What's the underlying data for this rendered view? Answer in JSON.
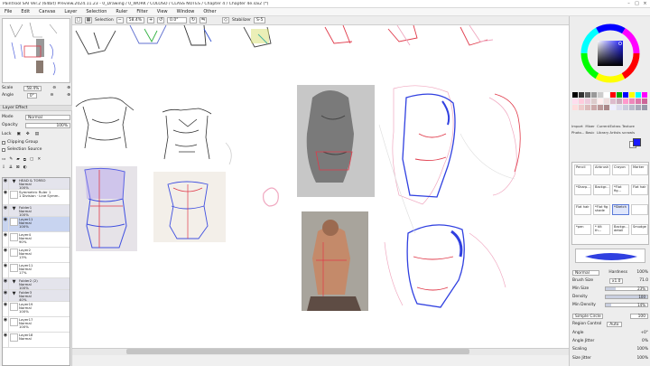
{
  "window": {
    "title": "PaintTool SAI Ver.2 (64bit) Preview.2024.11.23 - 0_Drawing / 0_WORK / COLOSO / CLASS NOTES / Chapter 4 / Chapter 4e.sai2 (*)",
    "controls": [
      "–",
      "□",
      "×"
    ]
  },
  "menu": [
    "File",
    "Edit",
    "Canvas",
    "Layer",
    "Selection",
    "Ruler",
    "Filter",
    "View",
    "Window",
    "Other"
  ],
  "toolbar": {
    "selection_label": "Selection",
    "zoom_value": "58.4%",
    "rotation_value": "0.0°",
    "stabilizer_label": "Stabilizer",
    "stabilizer_value": "S-5"
  },
  "left": {
    "scale_label": "Scale",
    "scale_value": "58.4%",
    "angle_label": "Angle",
    "angle_value": "0°",
    "layer_effect_label": "Layer Effect",
    "mode_label": "Mode",
    "mode_value": "Normal",
    "opacity_label": "Opacity",
    "opacity_value": "100%",
    "lock_label": "Lock",
    "clipping_label": "Clipping Group",
    "selsource_label": "Selection Source",
    "layers": [
      {
        "name": "HEAD & TORSO",
        "mode": "Normal",
        "opacity": "100%",
        "folder": true
      },
      {
        "name": "Symmetric Ruler 1",
        "mode": "1 Division · Line Symm.",
        "opacity": "",
        "folder": false
      },
      {
        "name": "Folder1",
        "mode": "Normal",
        "opacity": "100%",
        "folder": true
      },
      {
        "name": "Layer11",
        "mode": "Normal",
        "opacity": "100%",
        "folder": false,
        "selected": true
      },
      {
        "name": "Layer4",
        "mode": "Normal",
        "opacity": "90%",
        "folder": false
      },
      {
        "name": "Layer2",
        "mode": "Normal",
        "opacity": "13%",
        "folder": false
      },
      {
        "name": "Layer11",
        "mode": "Normal",
        "opacity": "17%",
        "folder": false
      },
      {
        "name": "Folder2 (2)",
        "mode": "Normal",
        "opacity": "100%",
        "folder": true
      },
      {
        "name": "Folder3",
        "mode": "Normal",
        "opacity": "40%",
        "folder": true
      },
      {
        "name": "Layer19",
        "mode": "Normal",
        "opacity": "100%",
        "folder": false
      },
      {
        "name": "Layer17",
        "mode": "Normal",
        "opacity": "100%",
        "folder": false
      },
      {
        "name": "Layer18",
        "mode": "Normal",
        "opacity": "",
        "folder": false
      }
    ]
  },
  "right": {
    "tab_row1": [
      "Import",
      "Mixer",
      "Current",
      "Extras",
      "Texture"
    ],
    "tab_row2": [
      "Photo...",
      "Basic",
      "Library",
      "Artists",
      "scrawls"
    ],
    "brushes": [
      "Pencil",
      "Airbrush",
      "Crayon",
      "Marker",
      "*Sharp...",
      "Backgr...",
      "*Flat fig...",
      "Flat hair",
      "Flat hair",
      "*Flat fig shade",
      "*Sketch",
      "",
      "*pen",
      "* tilt th...",
      "Backgr... detail",
      "Smudge"
    ],
    "selected_brush": "*Sketch",
    "mode_value": "Normal",
    "hardness_label": "Hardness",
    "hardness_value": "100%",
    "brush_size_label": "Brush Size",
    "brush_size_mult": "x1.0",
    "brush_size_value": "71.0",
    "min_size_label": "Min Size",
    "min_size_value": "23%",
    "density_label": "Density",
    "density_value": "100",
    "min_density_label": "Min Density",
    "min_density_value": "14%",
    "shape_label": "Simple Circle",
    "shape_value": "100",
    "region_label": "Region Control",
    "region_value": "Auto",
    "angle_label": "Angle",
    "angle_value": "+0°",
    "angle_jitter_label": "Angle Jitter",
    "angle_jitter_value": "0%",
    "scaling_label": "Scaling",
    "scaling_value": "100%",
    "size_jitter_label": "Size Jitter",
    "size_jitter_value": "100%"
  },
  "colors": {
    "accent": "#5a7ad8",
    "sketch_blue": "#3040e0",
    "sketch_red": "#e03a4a",
    "sketch_pink": "#f0a8c0",
    "foreground_swatch": "#1a1aff"
  },
  "levels": {
    "min_size": 0.23,
    "density": 1.0,
    "min_density": 0.14,
    "hardness": 1.0
  }
}
